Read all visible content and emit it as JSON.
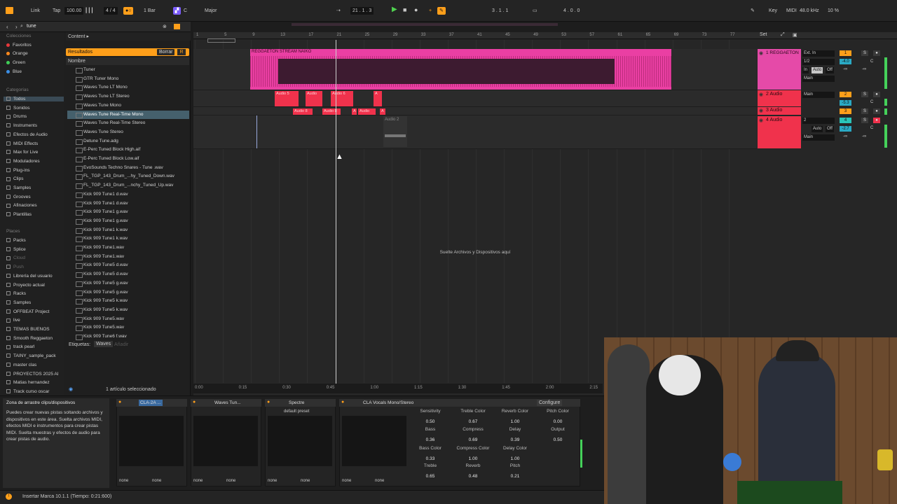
{
  "transport": {
    "link": "Link",
    "tap": "Tap",
    "tempo": "100.00",
    "meter": "4 / 4",
    "quantize": "1 Bar",
    "key": "C",
    "scale": "Major",
    "position": "21 .  1 .  3",
    "loop_start": "3 .  1 .  1",
    "loop_len": "4 .  0 .  0",
    "key_btn": "Key",
    "midi_btn": "MIDI",
    "sample_rate": "48.0 kHz",
    "cpu": "10 %"
  },
  "browser": {
    "search_value": "tune",
    "collections_header": "Colecciones",
    "collections": [
      {
        "label": "Favoritos",
        "color": "#e8383b"
      },
      {
        "label": "Orange",
        "color": "#ff8a1e"
      },
      {
        "label": "Green",
        "color": "#3fcf57"
      },
      {
        "label": "Blue",
        "color": "#3b8fe6"
      }
    ],
    "categories_header": "Categorías",
    "categories": [
      "Todos",
      "Sonidos",
      "Drums",
      "Instruments",
      "Efectos de Audio",
      "MIDI Effects",
      "Max for Live",
      "Moduladores",
      "Plug-ins",
      "Clips",
      "Samples",
      "Grooves",
      "Afinaciones",
      "Plantillas"
    ],
    "places_header": "Places",
    "places": [
      "Packs",
      "Splice",
      "Cloud",
      "Push",
      "Librería del usuario",
      "Proyecto actual",
      "Racks",
      "Samples",
      "OFFBEAT Project",
      "live",
      "TEMAS BUENOS",
      "Smooth Reggaeton",
      "track pearl",
      "TAINY_sample_pack",
      "master clas",
      "PROYECTOS 2025 AI",
      "Matias hernandez",
      "Track curso oscar"
    ],
    "content_label": "Content ▸",
    "results_label": "Resultados",
    "clear_label": "Borrar",
    "name_header": "Nombre",
    "files": [
      "Tuner",
      "GTR Tuner Mono",
      "Waves Tune LT Mono",
      "Waves Tune LT Stereo",
      "Waves Tune Mono",
      "Waves Tune Real-Time Mono",
      "Waves Tune Real-Time Stereo",
      "Waves Tune Stereo",
      "Detune Tune.adg",
      "E-Perc Tuned Block High.aif",
      "E-Perc Tuned Block Low.aif",
      "EvoSounds Techno Snares - Tune .wav",
      "FL_TGP_143_Drum_...hy_Tuned_Down.wav",
      "FL_TGP_143_Drum_...nchy_Tuned_Up.wav",
      "Kick 909 Tune1 d.wav",
      "Kick 909 Tune1 d.wav",
      "Kick 909 Tune1 g.wav",
      "Kick 909 Tune1 g.wav",
      "Kick 909 Tune1 k.wav",
      "Kick 909 Tune1 k.wav",
      "Kick 909 Tune1.wav",
      "Kick 909 Tune1.wav",
      "Kick 909 Tune5 d.wav",
      "Kick 909 Tune5 d.wav",
      "Kick 909 Tune5 g.wav",
      "Kick 909 Tune5 g.wav",
      "Kick 909 Tune5 k.wav",
      "Kick 909 Tune5 k.wav",
      "Kick 909 Tune5.wav",
      "Kick 909 Tune5.wav",
      "Kick 909 Tune6 f.wav"
    ],
    "selected_file_index": 5,
    "tags_label": "Etiquetas:",
    "tag": "Waves",
    "add_tag": "Añadir",
    "selection_count": "1 artículo seleccionado"
  },
  "arrangement": {
    "ruler": [
      "1",
      "5",
      "9",
      "13",
      "17",
      "21",
      "25",
      "29",
      "33",
      "37",
      "41",
      "45",
      "49",
      "53",
      "57",
      "61",
      "65",
      "69",
      "73",
      "77"
    ],
    "set_label": "Set",
    "main_clip": "REGGAETON STREAM NAIKO",
    "audio_clips_row1": [
      "Audio 5",
      "Audio",
      "Audio 6",
      "A"
    ],
    "audio_clips_row2": [
      "Audio 8",
      "Audio 8",
      "A",
      "Audio",
      "A"
    ],
    "ghost_clip": "Audio 2",
    "drop_text": "Suelte Archivos y Dispositivos aquí",
    "timeline": [
      "0:00",
      "0:15",
      "0:30",
      "0:45",
      "1:00",
      "1:15",
      "1:30",
      "1:45",
      "2:00",
      "2:15"
    ]
  },
  "tracks": [
    {
      "name": "1 REGGAETON",
      "color": "#e54aa8",
      "input": "Ext. In",
      "channel": "1/2",
      "monitor_in": "In",
      "monitor_auto": "Auto",
      "monitor_off": "Off",
      "out": "Main",
      "num": "1",
      "vol": "-4.0",
      "pan": "C",
      "send": "-∞"
    },
    {
      "name": "2 Audio",
      "color": "#f0324c",
      "out": "Main",
      "num": "2",
      "vol": "-5.3",
      "pan": "C"
    },
    {
      "name": "3 Audio",
      "color": "#f0324c",
      "num": "3"
    },
    {
      "name": "4 Audio",
      "color": "#f0324c",
      "input": "2",
      "monitor_auto": "Auto",
      "monitor_off": "Off",
      "out": "Main",
      "num": "4",
      "vol": "-2.7",
      "pan": "C",
      "send": "-∞"
    }
  ],
  "devices": {
    "info_title": "Zona de arrastre clips/dispositivos",
    "info_text": "Puedes crear nuevas pistas soltando archivos y dispositivos en este área. Suelta archivos MIDI, efectos MIDI e instrumentos para crear pistas MIDI. Suelta muestras y efectos de audio para crear pistas de audio.",
    "chain": [
      {
        "title": "CLA-2A ...",
        "out1": "none",
        "out2": "none"
      },
      {
        "title": "Waves Tun...",
        "out1": "none",
        "out2": "none"
      },
      {
        "title": "Spectre",
        "preset": "default preset",
        "out1": "none",
        "out2": "none"
      },
      {
        "title": "CLA Vocals Mono/Stereo",
        "out1": "none",
        "out2": "none",
        "configure": "Configure"
      }
    ],
    "params": [
      {
        "label": "Sensitivity",
        "value": "0.50"
      },
      {
        "label": "Treble Color",
        "value": "0.67"
      },
      {
        "label": "Reverb Color",
        "value": "1.00"
      },
      {
        "label": "Pitch Color",
        "value": "0.00"
      },
      {
        "label": "Bass",
        "value": "0.36"
      },
      {
        "label": "Compress",
        "value": "0.69"
      },
      {
        "label": "Delay",
        "value": "0.39"
      },
      {
        "label": "Output",
        "value": "0.50"
      },
      {
        "label": "Bass Color",
        "value": "0.33"
      },
      {
        "label": "Compress Color",
        "value": "1.00"
      },
      {
        "label": "Delay Color",
        "value": "1.00"
      },
      {
        "label": "Treble",
        "value": "0.65"
      },
      {
        "label": "Reverb",
        "value": "0.48"
      },
      {
        "label": "Pitch",
        "value": "0.21"
      }
    ]
  },
  "status": "Insertar Marca 10.1.1 (Tiempo: 0:21:600)"
}
